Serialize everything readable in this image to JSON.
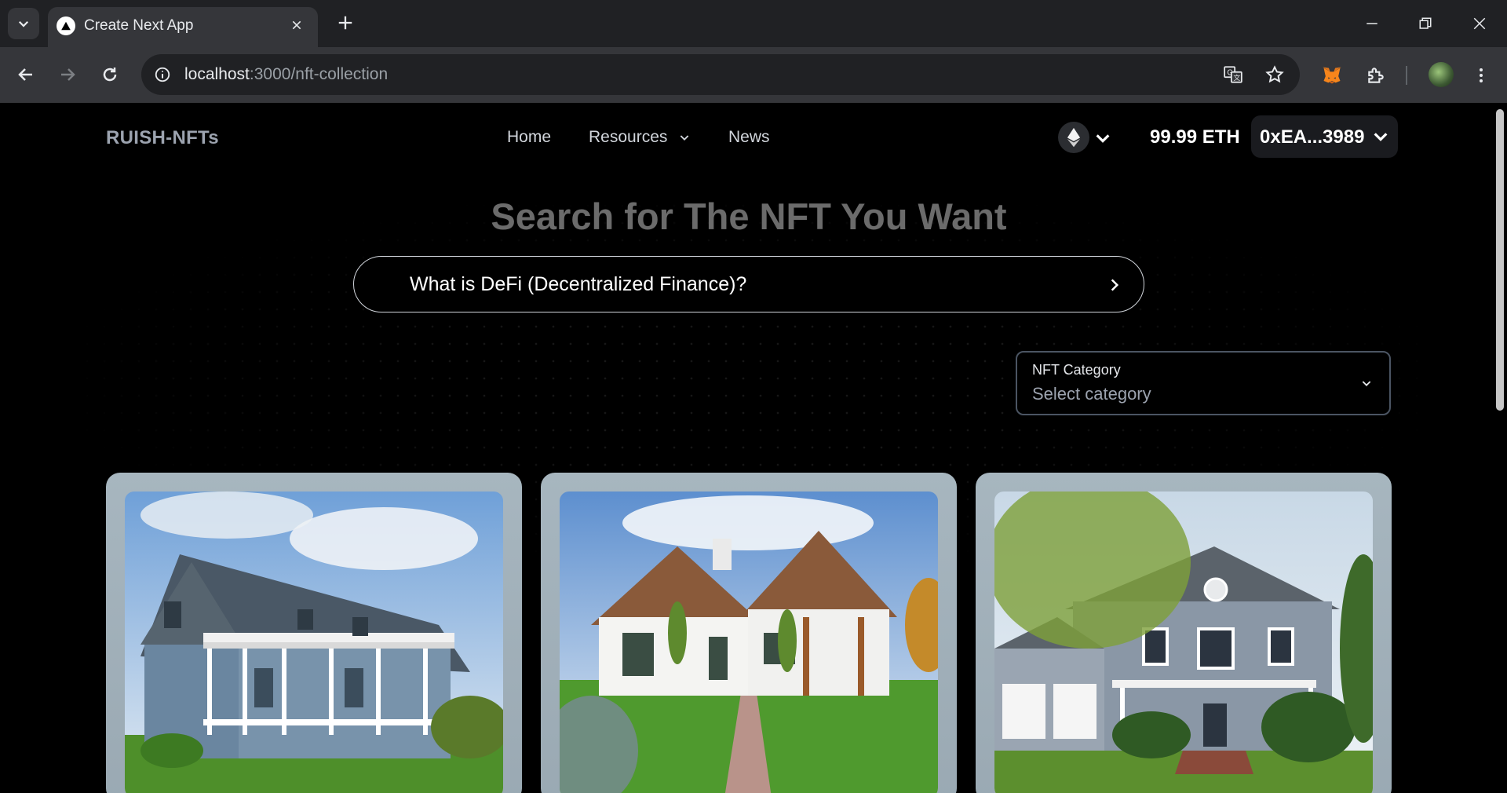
{
  "browser": {
    "tab_title": "Create Next App",
    "url_host": "localhost",
    "url_rest": ":3000/nft-collection"
  },
  "header": {
    "logo": "RUISH-NFTs",
    "nav": [
      {
        "label": "Home"
      },
      {
        "label": "Resources"
      },
      {
        "label": "News"
      }
    ],
    "balance": "99.99 ETH",
    "account": "0xEA...3989"
  },
  "hero": {
    "title": "Search for The NFT You Want",
    "search_value": "What is DeFi (Decentralized Finance)?"
  },
  "filter": {
    "label": "NFT Category",
    "placeholder": "Select category"
  },
  "colors": {
    "page_bg": "#000000",
    "card_bg": "#a7b6bf",
    "title_gray": "#6b6b6b"
  }
}
